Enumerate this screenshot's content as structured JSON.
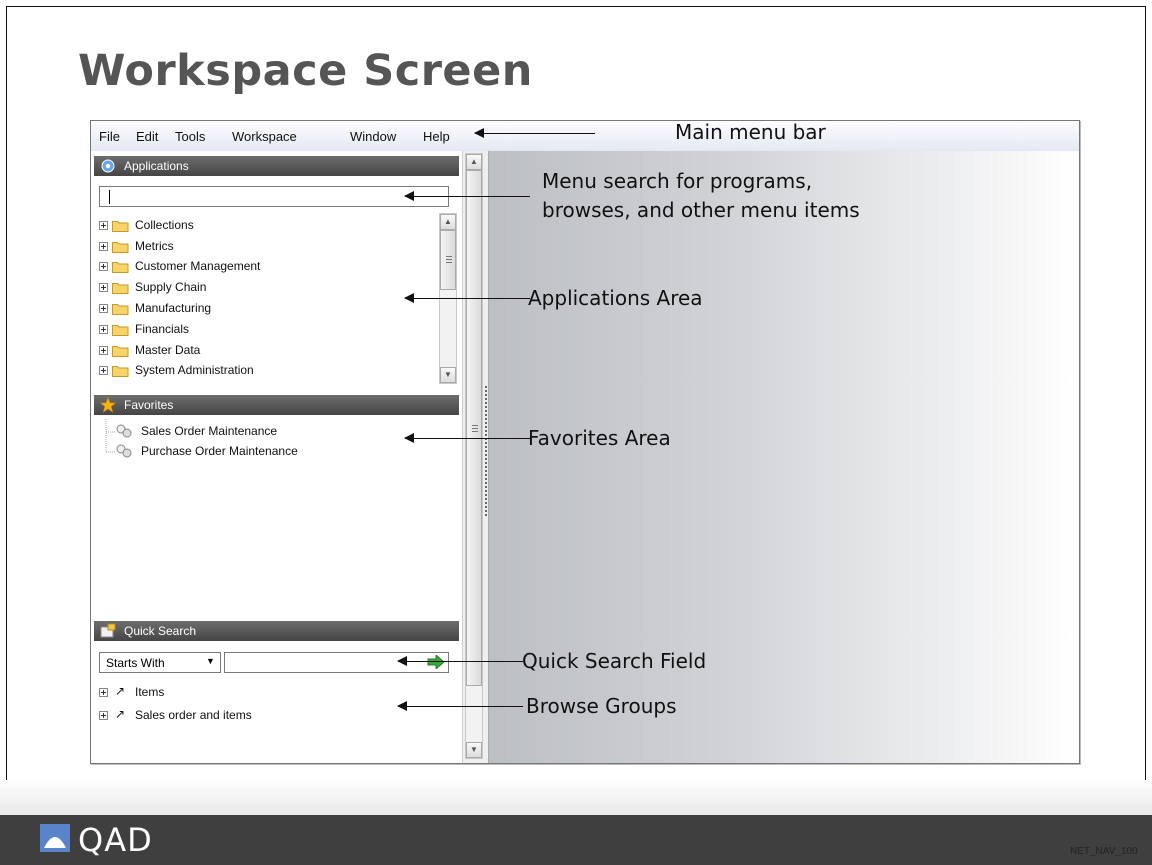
{
  "slide": {
    "title": "Workspace Screen",
    "footer_code": "NET_NAV_100",
    "logo_text": "QAD"
  },
  "menubar": {
    "items": [
      {
        "label": "File"
      },
      {
        "label": "Edit"
      },
      {
        "label": "Tools"
      },
      {
        "label": "Workspace"
      },
      {
        "label": "Window"
      },
      {
        "label": "Help"
      }
    ]
  },
  "applications": {
    "header": "Applications",
    "search_value": "",
    "items": [
      {
        "label": "Collections"
      },
      {
        "label": "Metrics"
      },
      {
        "label": "Customer Management"
      },
      {
        "label": "Supply Chain"
      },
      {
        "label": "Manufacturing"
      },
      {
        "label": "Financials"
      },
      {
        "label": "Master Data"
      },
      {
        "label": "System Administration"
      }
    ]
  },
  "favorites": {
    "header": "Favorites",
    "items": [
      {
        "label": "Sales Order Maintenance"
      },
      {
        "label": "Purchase Order Maintenance"
      }
    ]
  },
  "quick_search": {
    "header": "Quick Search",
    "mode": "Starts With",
    "value": "",
    "browse_groups": [
      {
        "label": "Items"
      },
      {
        "label": "Sales order and items"
      }
    ]
  },
  "annotations": {
    "main_menu_bar": "Main menu bar",
    "menu_search_line1": "Menu search for programs,",
    "menu_search_line2": "browses, and other menu items",
    "applications_area": "Applications Area",
    "favorites_area": "Favorites Area",
    "quick_search_field": "Quick Search Field",
    "browse_groups": "Browse Groups"
  },
  "colors": {
    "header_bg": "#4f4f4f",
    "footer_bg": "#3f3f3f",
    "title_color": "#555555"
  }
}
